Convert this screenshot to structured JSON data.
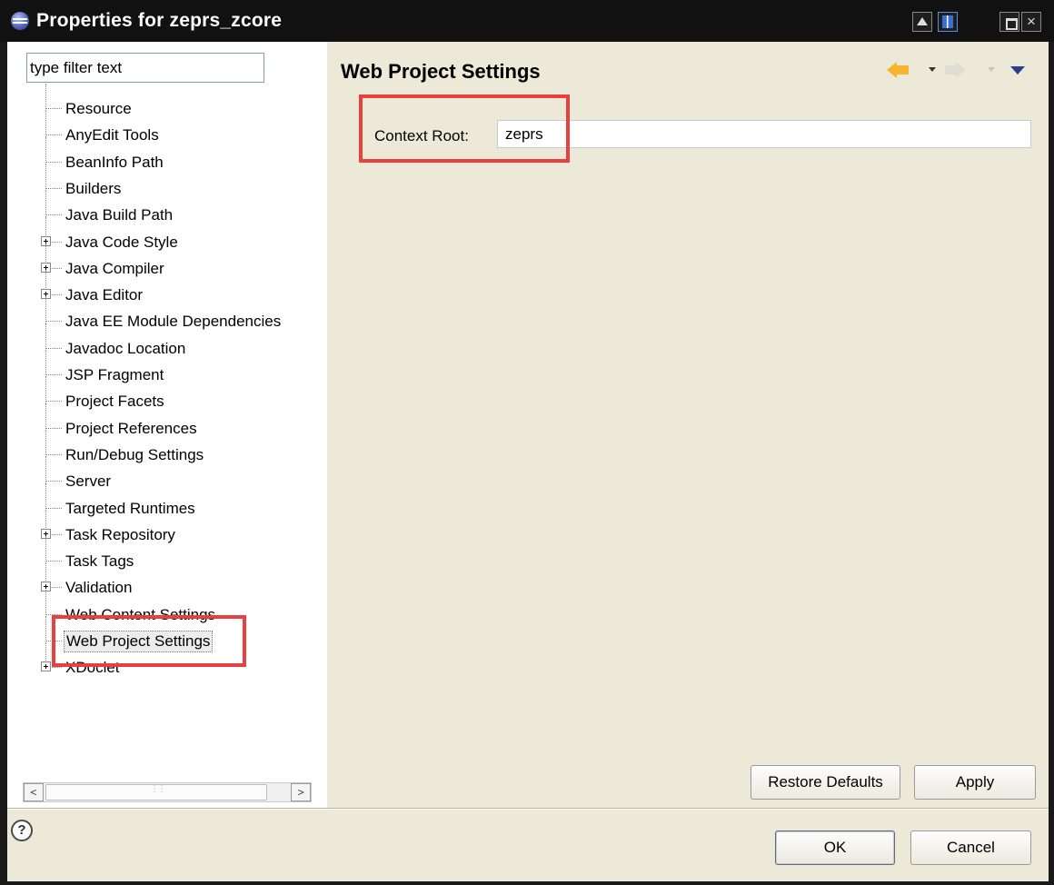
{
  "window": {
    "title": "Properties for zeprs_zcore"
  },
  "filter": {
    "value": "type filter text"
  },
  "tree": {
    "items": [
      {
        "label": "Resource",
        "expandable": false
      },
      {
        "label": "AnyEdit Tools",
        "expandable": false
      },
      {
        "label": "BeanInfo Path",
        "expandable": false
      },
      {
        "label": "Builders",
        "expandable": false
      },
      {
        "label": "Java Build Path",
        "expandable": false
      },
      {
        "label": "Java Code Style",
        "expandable": true
      },
      {
        "label": "Java Compiler",
        "expandable": true
      },
      {
        "label": "Java Editor",
        "expandable": true
      },
      {
        "label": "Java EE Module Dependencies",
        "expandable": false
      },
      {
        "label": "Javadoc Location",
        "expandable": false
      },
      {
        "label": "JSP Fragment",
        "expandable": false
      },
      {
        "label": "Project Facets",
        "expandable": false
      },
      {
        "label": "Project References",
        "expandable": false
      },
      {
        "label": "Run/Debug Settings",
        "expandable": false
      },
      {
        "label": "Server",
        "expandable": false
      },
      {
        "label": "Targeted Runtimes",
        "expandable": false
      },
      {
        "label": "Task Repository",
        "expandable": true
      },
      {
        "label": "Task Tags",
        "expandable": false
      },
      {
        "label": "Validation",
        "expandable": true
      },
      {
        "label": "Web Content Settings",
        "expandable": false
      },
      {
        "label": "Web Project Settings",
        "expandable": false,
        "selected": true
      },
      {
        "label": "XDoclet",
        "expandable": true
      }
    ]
  },
  "page": {
    "title": "Web Project Settings",
    "context_root_label": "Context Root:",
    "context_root_value": "zeprs"
  },
  "buttons": {
    "restore_defaults": "Restore Defaults",
    "apply": "Apply",
    "ok": "OK",
    "cancel": "Cancel"
  },
  "help": {
    "glyph": "?"
  },
  "titlebar_buttons": {
    "close": "×"
  },
  "scrollbar": {
    "left": "<",
    "right": ">"
  },
  "colors": {
    "highlight": "#e8403f",
    "dialog_bg": "#ece9d8",
    "titlebar_bg": "#111111"
  }
}
